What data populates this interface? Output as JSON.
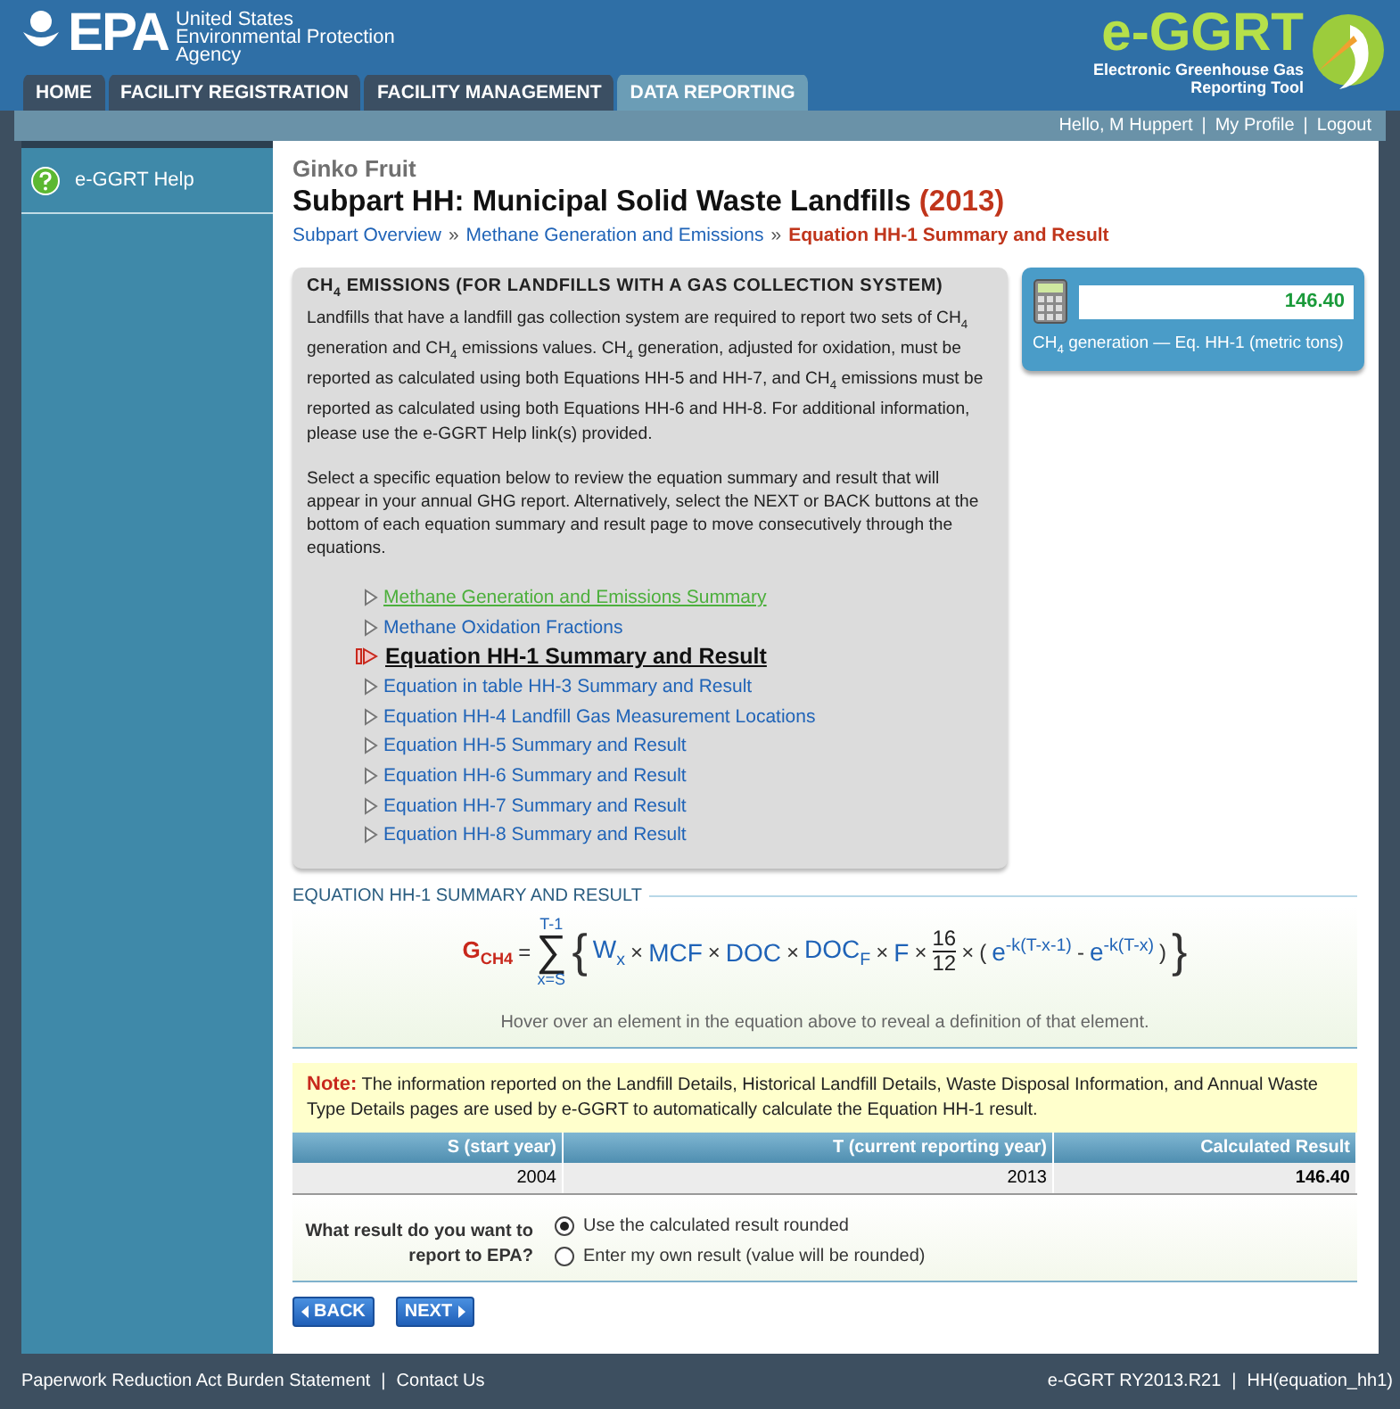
{
  "header": {
    "agency_lines": [
      "United States",
      "Environmental Protection",
      "Agency"
    ],
    "logo_text": "EPA",
    "app_name": "e-GGRT",
    "app_subtitle_lines": [
      "Electronic Greenhouse Gas",
      "Reporting Tool"
    ]
  },
  "tabs": [
    {
      "label": "HOME",
      "selected": false
    },
    {
      "label": "FACILITY REGISTRATION",
      "selected": false
    },
    {
      "label": "FACILITY MANAGEMENT",
      "selected": false
    },
    {
      "label": "DATA REPORTING",
      "selected": true
    }
  ],
  "user_links": [
    "Hello, M Huppert",
    "My Profile",
    "Logout"
  ],
  "link_separator": "|",
  "sidebar": {
    "items": [
      {
        "label": "e-GGRT Help"
      }
    ]
  },
  "facility": "Ginko Fruit",
  "page_title": {
    "text": "Subpart HH: Municipal Solid Waste Landfills",
    "year": "(2013)"
  },
  "breadcrumb": [
    {
      "label": "Subpart Overview",
      "current": false
    },
    {
      "label": "Methane Generation and Emissions",
      "current": false
    },
    {
      "label": "Equation HH-1 Summary and Result",
      "current": true
    }
  ],
  "breadcrumb_separator": "»",
  "info_panel": {
    "title": "CH$_{4}$ EMISSIONS (FOR LANDFILLS WITH A GAS COLLECTION SYSTEM)",
    "paragraphs": [
      "Landfills that have a landfill gas collection system are required to report two sets of CH$_{4}$ generation and CH$_{4}$ emissions values. CH$_{4}$ generation, adjusted for oxidation, must be reported as calculated using both Equations HH-5 and HH-7, and CH$_{4}$ emissions must be reported as calculated using both Equations HH-6 and HH-8. For additional information, please use the e-GGRT Help link(s) provided.",
      "Select a specific equation below to review the equation summary and result that will appear in your annual GHG report. Alternatively, select the NEXT or BACK buttons at the bottom of each equation summary and result page to move consecutively through the equations."
    ],
    "links": [
      {
        "label": "Methane Generation and Emissions Summary",
        "selected": false,
        "visited": true
      },
      {
        "label": "Methane Oxidation Fractions",
        "selected": false,
        "visited": false
      },
      {
        "label": "Equation HH-1 Summary and Result",
        "selected": true,
        "visited": false
      },
      {
        "label": "Equation in table HH-3 Summary and Result",
        "selected": false,
        "visited": false
      },
      {
        "label": "Equation HH-4 Landfill Gas Measurement Locations",
        "selected": false,
        "visited": false
      },
      {
        "label": "Equation HH-5 Summary and Result",
        "selected": false,
        "visited": false
      },
      {
        "label": "Equation HH-6 Summary and Result",
        "selected": false,
        "visited": false
      },
      {
        "label": "Equation HH-7 Summary and Result",
        "selected": false,
        "visited": false
      },
      {
        "label": "Equation HH-8 Summary and Result",
        "selected": false,
        "visited": false
      }
    ]
  },
  "result_widget": {
    "value": "146.40",
    "label": "CH$_{4}$ generation — Eq. HH-1 (metric tons)"
  },
  "equation_section": {
    "title": "EQUATION HH-1 SUMMARY AND RESULT",
    "lhs": "G$_{CH4}$",
    "equals": "=",
    "sum": {
      "sign": "∑",
      "upper": "T-1",
      "lower": "x=S"
    },
    "open": "{",
    "close": "}",
    "terms": [
      {
        "kind": "var",
        "text": "W$_{x}$"
      },
      {
        "kind": "op",
        "text": "×"
      },
      {
        "kind": "var",
        "text": "MCF"
      },
      {
        "kind": "op",
        "text": "×"
      },
      {
        "kind": "var",
        "text": "DOC"
      },
      {
        "kind": "op",
        "text": "×"
      },
      {
        "kind": "var",
        "text": "DOC$_{F}$"
      },
      {
        "kind": "op",
        "text": "×"
      },
      {
        "kind": "var",
        "text": "F"
      },
      {
        "kind": "op",
        "text": "×"
      },
      {
        "kind": "frac",
        "num": "16",
        "den": "12"
      },
      {
        "kind": "op",
        "text": "×"
      },
      {
        "kind": "op",
        "text": "("
      },
      {
        "kind": "var",
        "text": "e$^{-k(T-x-1)}$"
      },
      {
        "kind": "op",
        "text": "-"
      },
      {
        "kind": "var",
        "text": "e$^{-k(T-x)}$"
      },
      {
        "kind": "op",
        "text": ")"
      }
    ],
    "hint": "Hover over an element in the equation above to reveal a definition of that element."
  },
  "note": {
    "label": "Note:",
    "text": "The information reported on the Landfill Details, Historical Landfill Details, Waste Disposal Information, and Annual Waste Type Details pages are used by e-GGRT to automatically calculate the Equation HH-1 result."
  },
  "table": {
    "columns": [
      "S (start year)",
      "T (current reporting year)",
      "Calculated Result"
    ],
    "rows": [
      [
        "2004",
        "2013",
        "146.40"
      ]
    ]
  },
  "question": {
    "label": "What result do you want to report to EPA?",
    "options": [
      {
        "label": "Use the calculated result rounded",
        "selected": true
      },
      {
        "label": "Enter my own result (value will be rounded)",
        "selected": false
      }
    ]
  },
  "buttons": {
    "back": "BACK",
    "next": "NEXT"
  },
  "footer": {
    "left": [
      "Paperwork Reduction Act Burden Statement",
      "Contact Us"
    ],
    "right": [
      "e-GGRT RY2013.R21",
      "HH(equation_hh1)"
    ]
  }
}
